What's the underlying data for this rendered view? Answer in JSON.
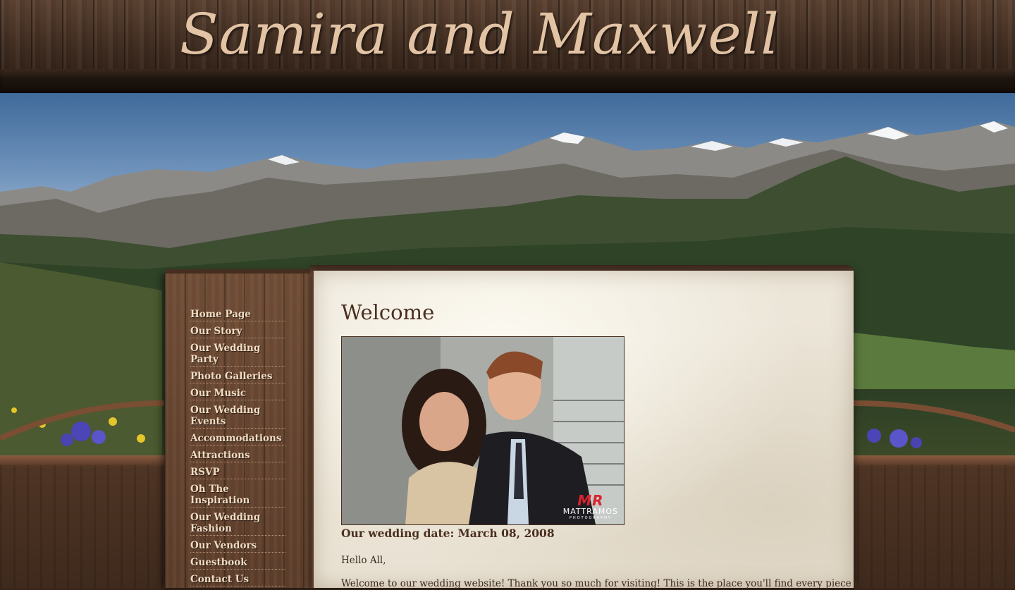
{
  "site": {
    "title": "Samira and Maxwell"
  },
  "nav": {
    "items": [
      {
        "label": "Home Page"
      },
      {
        "label": "Our Story"
      },
      {
        "label": "Our Wedding Party"
      },
      {
        "label": "Photo Galleries"
      },
      {
        "label": "Our Music"
      },
      {
        "label": "Our Wedding Events"
      },
      {
        "label": "Accommodations"
      },
      {
        "label": "Attractions"
      },
      {
        "label": "RSVP"
      },
      {
        "label": "Oh The Inspiration"
      },
      {
        "label": "Our Wedding Fashion"
      },
      {
        "label": "Our Vendors"
      },
      {
        "label": "Guestbook"
      },
      {
        "label": "Contact Us"
      }
    ]
  },
  "main": {
    "title": "Welcome",
    "photo_credit": {
      "mark": "MR",
      "name": "MATTRAMOS",
      "sub": "PHOTOGRAPHY"
    },
    "wedding_date": "Our wedding date: March 08, 2008",
    "greeting": "Hello All,",
    "intro": "Welcome to our wedding website! Thank you so much for visiting! This is the place you'll find every piece of"
  },
  "colors": {
    "title_text": "#e2c3a4",
    "nav_text": "#f1dcc3",
    "heading_text": "#4a2f20",
    "paper": "#ece6d9",
    "wood_dark": "#3a2619"
  },
  "icons": {
    "logo": "mattramos-logo"
  }
}
